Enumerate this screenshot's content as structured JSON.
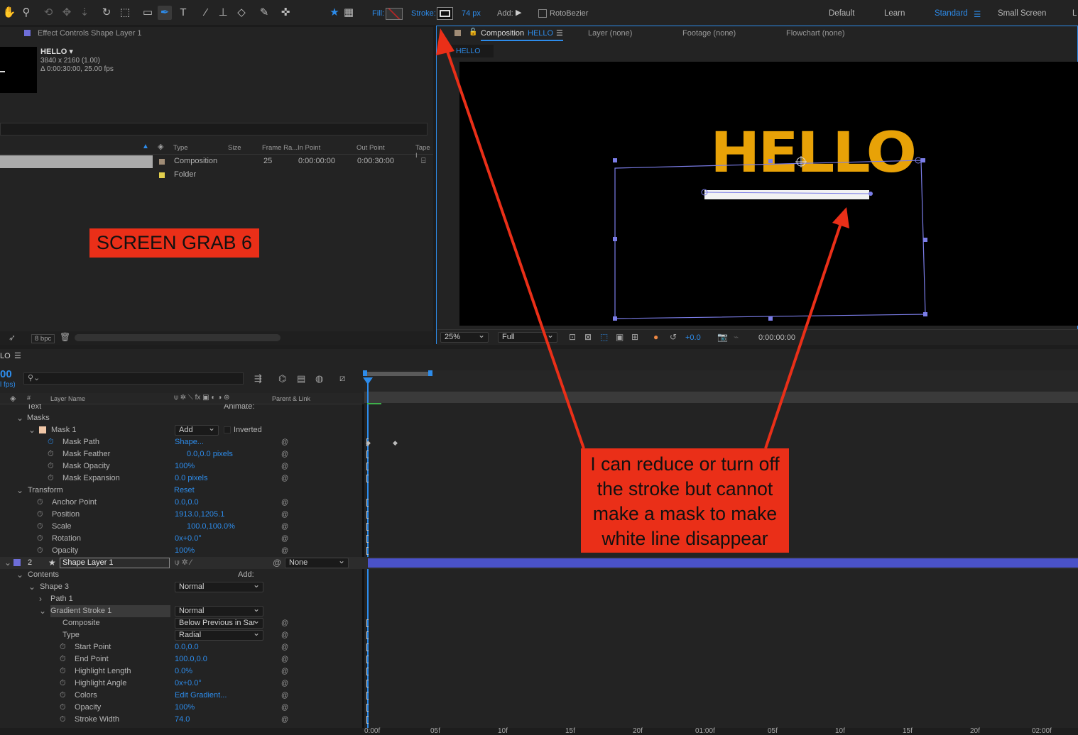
{
  "toolbar": {
    "fill_label": "Fill:",
    "stroke_label": "Stroke:",
    "stroke_width": "74 px",
    "add_label": "Add:",
    "rotobezier": "RotoBezier",
    "workspaces": [
      "Default",
      "Learn",
      "Standard",
      "Small Screen",
      "L"
    ]
  },
  "project": {
    "tab_title": "Effect Controls Shape Layer 1",
    "comp_name": "HELLO ▾",
    "comp_res": "3840 x 2160 (1.00)",
    "comp_dur": "Δ 0:00:30:00, 25.00 fps",
    "columns": [
      "Type",
      "Size",
      "Frame Ra...",
      "In Point",
      "Out Point",
      "Tape I"
    ],
    "rows": [
      {
        "type": "Composition",
        "fps": "25",
        "in": "0:00:00:00",
        "out": "0:00:30:00",
        "color": "#a08c76"
      },
      {
        "type": "Folder",
        "fps": "",
        "in": "",
        "out": "",
        "color": "#e2cf4d"
      }
    ],
    "bpc": "8 bpc",
    "watermark": "SCREEN GRAB 6"
  },
  "viewer": {
    "tabs": [
      "Composition",
      "HELLO",
      "Layer (none)",
      "Footage (none)",
      "Flowchart (none)"
    ],
    "crumb": "HELLO",
    "title_text": "HELLO",
    "zoom": "25%",
    "resolution": "Full",
    "exposure": "+0.0",
    "timecode": "0:00:00:00"
  },
  "timeline": {
    "tab": "LO",
    "time": "00",
    "fps": "l fps)",
    "search_placeholder": "",
    "col_layer": "Layer Name",
    "col_parent": "Parent & Link",
    "col_num": "#",
    "ticks": [
      "0:00f",
      "05f",
      "10f",
      "15f",
      "20f",
      "01:00f",
      "05f",
      "10f",
      "15f",
      "20f",
      "02:00f"
    ],
    "props": [
      {
        "label": "Text",
        "value": "Animate:",
        "indent": 0
      },
      {
        "label": "Masks",
        "value": "",
        "indent": 1
      },
      {
        "label": "Mask 1",
        "value": "Add",
        "extra": "Inverted",
        "indent": 2
      },
      {
        "label": "Mask Path",
        "value": "Shape...",
        "indent": 3
      },
      {
        "label": "Mask Feather",
        "value": "0.0,0.0 pixels",
        "indent": 3
      },
      {
        "label": "Mask Opacity",
        "value": "100%",
        "indent": 3
      },
      {
        "label": "Mask Expansion",
        "value": "0.0 pixels",
        "indent": 3
      },
      {
        "label": "Transform",
        "value": "Reset",
        "indent": 1
      },
      {
        "label": "Anchor Point",
        "value": "0.0,0.0",
        "indent": 2
      },
      {
        "label": "Position",
        "value": "1913.0,1205.1",
        "indent": 2
      },
      {
        "label": "Scale",
        "value": "100.0,100.0%",
        "indent": 2
      },
      {
        "label": "Rotation",
        "value": "0x+0.0°",
        "indent": 2
      },
      {
        "label": "Opacity",
        "value": "100%",
        "indent": 2
      }
    ],
    "layer2": {
      "num": "2",
      "name": "Shape Layer 1",
      "parent": "None"
    },
    "props2": [
      {
        "label": "Contents",
        "value": "Add:",
        "indent": 1
      },
      {
        "label": "Shape 3",
        "value": "Normal",
        "indent": 2
      },
      {
        "label": "Path 1",
        "value": "",
        "indent": 3
      },
      {
        "label": "Gradient Stroke 1",
        "value": "Normal",
        "indent": 3
      },
      {
        "label": "Composite",
        "value": "Below Previous in Sar",
        "indent": 4
      },
      {
        "label": "Type",
        "value": "Radial",
        "indent": 4
      },
      {
        "label": "Start Point",
        "value": "0.0,0.0",
        "indent": 4
      },
      {
        "label": "End Point",
        "value": "100.0,0.0",
        "indent": 4
      },
      {
        "label": "Highlight Length",
        "value": "0.0%",
        "indent": 4
      },
      {
        "label": "Highlight Angle",
        "value": "0x+0.0°",
        "indent": 4
      },
      {
        "label": "Colors",
        "value": "Edit Gradient...",
        "indent": 4
      },
      {
        "label": "Opacity",
        "value": "100%",
        "indent": 4
      },
      {
        "label": "Stroke Width",
        "value": "74.0",
        "indent": 4
      }
    ]
  },
  "annotation": {
    "lines": [
      "I can reduce or turn off",
      "the stroke but cannot",
      "make a mask to make",
      "white line disappear"
    ]
  },
  "colors": {
    "accent": "#2d8ceb",
    "annotation": "#ea2f18",
    "hello": "#e8a207",
    "mask": "#7b7de8"
  }
}
